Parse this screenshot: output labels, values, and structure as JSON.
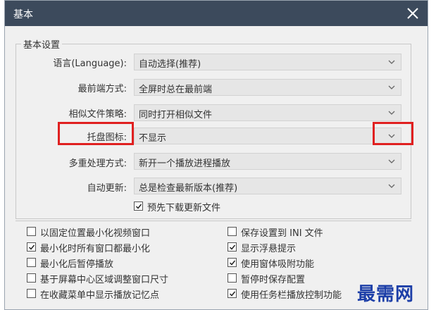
{
  "window": {
    "title": "基本",
    "close_icon": "close-icon"
  },
  "group": {
    "legend": "基本设置"
  },
  "settings": [
    {
      "label": "语言(Language):",
      "value": "自动选择(推荐)"
    },
    {
      "label": "最前端方式:",
      "value": "全屏时总在最前端"
    },
    {
      "label": "相似文件策略:",
      "value": "同时打开相似文件"
    },
    {
      "label": "托盘图标:",
      "value": "不显示"
    },
    {
      "label": "多重处理方式:",
      "value": "新开一个播放进程播放"
    },
    {
      "label": "自动更新:",
      "value": "总是检查最新版本(推荐)"
    }
  ],
  "predownload": {
    "label": "预先下载更新文件",
    "checked": true
  },
  "options_left": [
    {
      "label": "以固定位置最小化视频窗口",
      "checked": false
    },
    {
      "label": "最小化时所有窗口都最小化",
      "checked": true
    },
    {
      "label": "最小化后暂停播放",
      "checked": false
    },
    {
      "label": "基于屏幕中心区域调整窗口尺寸",
      "checked": false
    },
    {
      "label": "在收藏菜单中显示播放记忆点",
      "checked": false
    }
  ],
  "options_right": [
    {
      "label": "保存设置到 INI 文件",
      "checked": false
    },
    {
      "label": "显示浮悬提示",
      "checked": true
    },
    {
      "label": "使用窗体吸附功能",
      "checked": true
    },
    {
      "label": "暂停时保存配置",
      "checked": false
    },
    {
      "label": "使用任务栏播放控制功能",
      "checked": true
    }
  ],
  "watermark": "最需网",
  "colors": {
    "titlebar": "#3c4a5c",
    "highlight": "#e02020",
    "watermark": "#1d3fa8"
  }
}
